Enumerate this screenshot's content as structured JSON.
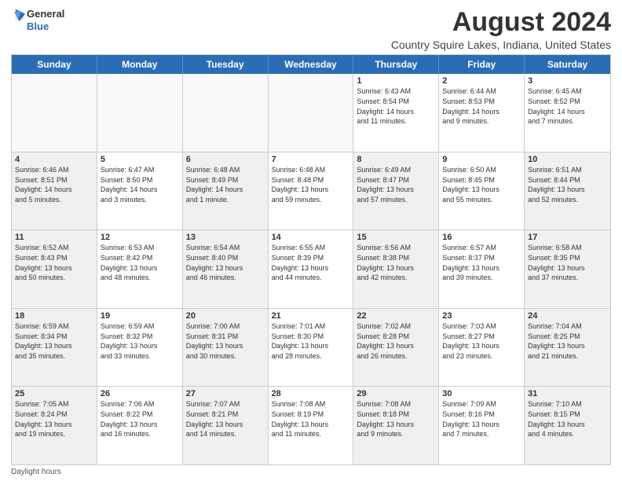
{
  "logo": {
    "general": "General",
    "blue": "Blue"
  },
  "title": "August 2024",
  "subtitle": "Country Squire Lakes, Indiana, United States",
  "weekdays": [
    "Sunday",
    "Monday",
    "Tuesday",
    "Wednesday",
    "Thursday",
    "Friday",
    "Saturday"
  ],
  "footer": "Daylight hours",
  "weeks": [
    [
      {
        "day": "",
        "info": "",
        "empty": true
      },
      {
        "day": "",
        "info": "",
        "empty": true
      },
      {
        "day": "",
        "info": "",
        "empty": true
      },
      {
        "day": "",
        "info": "",
        "empty": true
      },
      {
        "day": "1",
        "info": "Sunrise: 6:43 AM\nSunset: 8:54 PM\nDaylight: 14 hours\nand 11 minutes."
      },
      {
        "day": "2",
        "info": "Sunrise: 6:44 AM\nSunset: 8:53 PM\nDaylight: 14 hours\nand 9 minutes."
      },
      {
        "day": "3",
        "info": "Sunrise: 6:45 AM\nSunset: 8:52 PM\nDaylight: 14 hours\nand 7 minutes."
      }
    ],
    [
      {
        "day": "4",
        "info": "Sunrise: 6:46 AM\nSunset: 8:51 PM\nDaylight: 14 hours\nand 5 minutes.",
        "shaded": true
      },
      {
        "day": "5",
        "info": "Sunrise: 6:47 AM\nSunset: 8:50 PM\nDaylight: 14 hours\nand 3 minutes."
      },
      {
        "day": "6",
        "info": "Sunrise: 6:48 AM\nSunset: 8:49 PM\nDaylight: 14 hours\nand 1 minute.",
        "shaded": true
      },
      {
        "day": "7",
        "info": "Sunrise: 6:48 AM\nSunset: 8:48 PM\nDaylight: 13 hours\nand 59 minutes."
      },
      {
        "day": "8",
        "info": "Sunrise: 6:49 AM\nSunset: 8:47 PM\nDaylight: 13 hours\nand 57 minutes.",
        "shaded": true
      },
      {
        "day": "9",
        "info": "Sunrise: 6:50 AM\nSunset: 8:45 PM\nDaylight: 13 hours\nand 55 minutes."
      },
      {
        "day": "10",
        "info": "Sunrise: 6:51 AM\nSunset: 8:44 PM\nDaylight: 13 hours\nand 52 minutes.",
        "shaded": true
      }
    ],
    [
      {
        "day": "11",
        "info": "Sunrise: 6:52 AM\nSunset: 8:43 PM\nDaylight: 13 hours\nand 50 minutes.",
        "shaded": true
      },
      {
        "day": "12",
        "info": "Sunrise: 6:53 AM\nSunset: 8:42 PM\nDaylight: 13 hours\nand 48 minutes."
      },
      {
        "day": "13",
        "info": "Sunrise: 6:54 AM\nSunset: 8:40 PM\nDaylight: 13 hours\nand 46 minutes.",
        "shaded": true
      },
      {
        "day": "14",
        "info": "Sunrise: 6:55 AM\nSunset: 8:39 PM\nDaylight: 13 hours\nand 44 minutes."
      },
      {
        "day": "15",
        "info": "Sunrise: 6:56 AM\nSunset: 8:38 PM\nDaylight: 13 hours\nand 42 minutes.",
        "shaded": true
      },
      {
        "day": "16",
        "info": "Sunrise: 6:57 AM\nSunset: 8:37 PM\nDaylight: 13 hours\nand 39 minutes."
      },
      {
        "day": "17",
        "info": "Sunrise: 6:58 AM\nSunset: 8:35 PM\nDaylight: 13 hours\nand 37 minutes.",
        "shaded": true
      }
    ],
    [
      {
        "day": "18",
        "info": "Sunrise: 6:59 AM\nSunset: 8:34 PM\nDaylight: 13 hours\nand 35 minutes.",
        "shaded": true
      },
      {
        "day": "19",
        "info": "Sunrise: 6:59 AM\nSunset: 8:32 PM\nDaylight: 13 hours\nand 33 minutes."
      },
      {
        "day": "20",
        "info": "Sunrise: 7:00 AM\nSunset: 8:31 PM\nDaylight: 13 hours\nand 30 minutes.",
        "shaded": true
      },
      {
        "day": "21",
        "info": "Sunrise: 7:01 AM\nSunset: 8:30 PM\nDaylight: 13 hours\nand 28 minutes."
      },
      {
        "day": "22",
        "info": "Sunrise: 7:02 AM\nSunset: 8:28 PM\nDaylight: 13 hours\nand 26 minutes.",
        "shaded": true
      },
      {
        "day": "23",
        "info": "Sunrise: 7:03 AM\nSunset: 8:27 PM\nDaylight: 13 hours\nand 23 minutes."
      },
      {
        "day": "24",
        "info": "Sunrise: 7:04 AM\nSunset: 8:25 PM\nDaylight: 13 hours\nand 21 minutes.",
        "shaded": true
      }
    ],
    [
      {
        "day": "25",
        "info": "Sunrise: 7:05 AM\nSunset: 8:24 PM\nDaylight: 13 hours\nand 19 minutes.",
        "shaded": true
      },
      {
        "day": "26",
        "info": "Sunrise: 7:06 AM\nSunset: 8:22 PM\nDaylight: 13 hours\nand 16 minutes."
      },
      {
        "day": "27",
        "info": "Sunrise: 7:07 AM\nSunset: 8:21 PM\nDaylight: 13 hours\nand 14 minutes.",
        "shaded": true
      },
      {
        "day": "28",
        "info": "Sunrise: 7:08 AM\nSunset: 8:19 PM\nDaylight: 13 hours\nand 11 minutes."
      },
      {
        "day": "29",
        "info": "Sunrise: 7:08 AM\nSunset: 8:18 PM\nDaylight: 13 hours\nand 9 minutes.",
        "shaded": true
      },
      {
        "day": "30",
        "info": "Sunrise: 7:09 AM\nSunset: 8:16 PM\nDaylight: 13 hours\nand 7 minutes."
      },
      {
        "day": "31",
        "info": "Sunrise: 7:10 AM\nSunset: 8:15 PM\nDaylight: 13 hours\nand 4 minutes.",
        "shaded": true
      }
    ]
  ]
}
